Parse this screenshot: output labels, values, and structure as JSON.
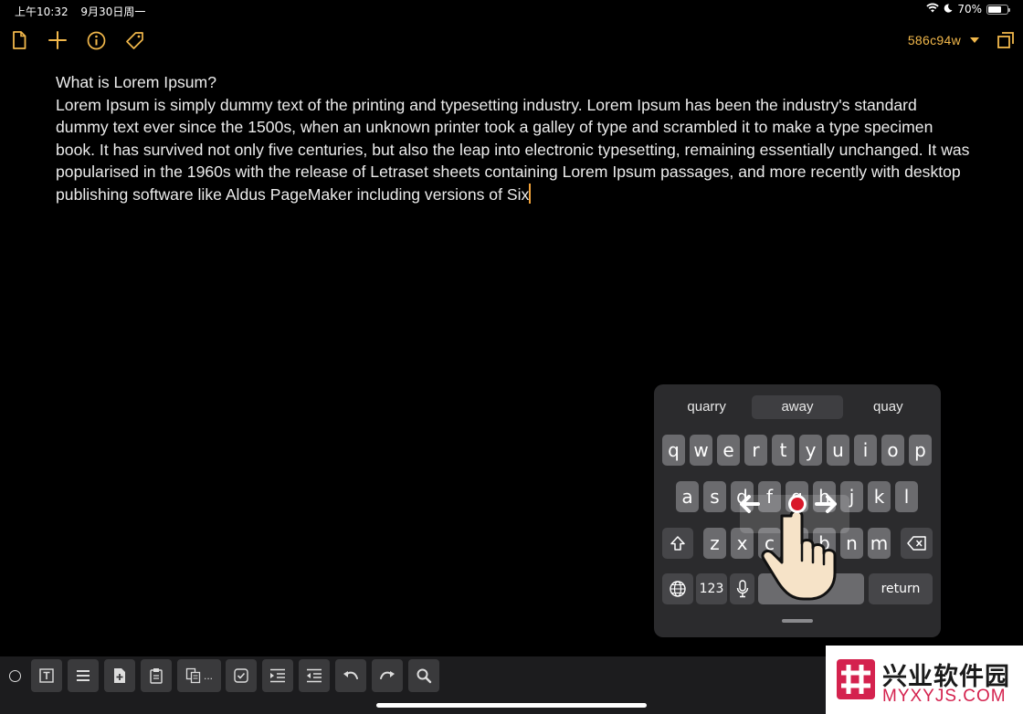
{
  "status": {
    "time": "上午10:32",
    "date": "9月30日周一",
    "battery": "70%",
    "battery_level": 0.7
  },
  "toolbar": {
    "branch": "586c94w"
  },
  "editor": {
    "heading": "What is Lorem Ipsum?",
    "body": "Lorem Ipsum is simply dummy text of the printing and typesetting industry. Lorem Ipsum has been the industry's standard dummy text ever since the 1500s, when an unknown printer took a galley of type and scrambled it to make a type specimen book. It has survived not only five centuries, but also the leap into electronic typesetting, remaining essentially unchanged. It was popularised in the 1960s with the release of Letraset sheets containing Lorem Ipsum passages, and more recently with desktop publishing software like Aldus PageMaker including versions of Six"
  },
  "keyboard": {
    "suggestions": [
      "quarry",
      "away",
      "quay"
    ],
    "row1": [
      "q",
      "w",
      "e",
      "r",
      "t",
      "y",
      "u",
      "i",
      "o",
      "p"
    ],
    "row2": [
      "a",
      "s",
      "d",
      "f",
      "g",
      "h",
      "j",
      "k",
      "l"
    ],
    "row3": [
      "z",
      "x",
      "c",
      "v",
      "b",
      "n",
      "m"
    ],
    "numbers_label": "123",
    "return_label": "return"
  },
  "bottom_toolbar": {
    "copy_more": "..."
  },
  "watermark": {
    "title": "兴业软件园",
    "subtitle": "MYXYJS.COM"
  }
}
